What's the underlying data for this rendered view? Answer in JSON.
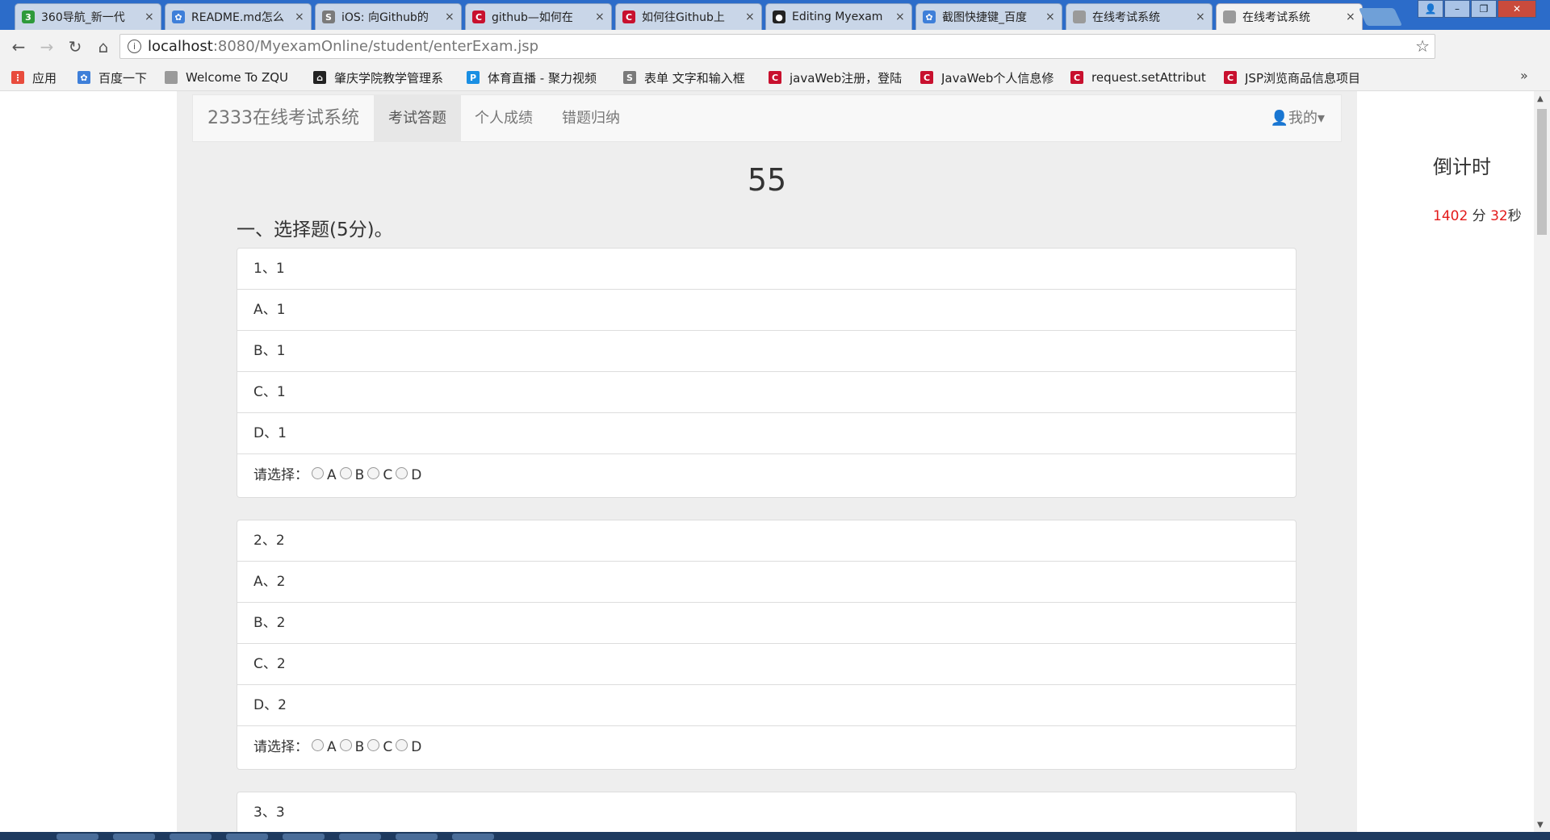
{
  "browser": {
    "tabs": [
      {
        "title": "360导航_新一代",
        "color": "#2e9a3b",
        "glyph": "3"
      },
      {
        "title": "README.md怎么",
        "color": "#3e7fd9",
        "glyph": "✿"
      },
      {
        "title": "iOS: 向Github的",
        "color": "#7a7a7a",
        "glyph": "S"
      },
      {
        "title": "github—如何在",
        "color": "#c8102e",
        "glyph": "C"
      },
      {
        "title": "如何往Github上",
        "color": "#c8102e",
        "glyph": "C"
      },
      {
        "title": "Editing Myexam",
        "color": "#222222",
        "glyph": "●"
      },
      {
        "title": "截图快捷键_百度",
        "color": "#3e7fd9",
        "glyph": "✿"
      },
      {
        "title": "在线考试系统",
        "color": "#9a9a9a",
        "glyph": ""
      },
      {
        "title": "在线考试系统",
        "color": "#9a9a9a",
        "glyph": ""
      }
    ],
    "tab_close": "×",
    "url_host": "localhost",
    "url_path": ":8080/MyexamOnline/student/enterExam.jsp",
    "bookmarks": [
      {
        "label": "应用",
        "color": "#e84c3d",
        "glyph": "⋮"
      },
      {
        "label": "百度一下",
        "color": "#3e7fd9",
        "glyph": "✿"
      },
      {
        "label": "Welcome To ZQU",
        "color": "#9a9a9a",
        "glyph": ""
      },
      {
        "label": "肇庆学院教学管理系",
        "color": "#222222",
        "glyph": "⌂"
      },
      {
        "label": "体育直播 - 聚力视频",
        "color": "#1a8fe3",
        "glyph": "P"
      },
      {
        "label": "表单 文字和输入框",
        "color": "#7a7a7a",
        "glyph": "S"
      },
      {
        "label": "javaWeb注册，登陆",
        "color": "#c8102e",
        "glyph": "C"
      },
      {
        "label": "JavaWeb个人信息修",
        "color": "#c8102e",
        "glyph": "C"
      },
      {
        "label": "request.setAttribut",
        "color": "#c8102e",
        "glyph": "C"
      },
      {
        "label": "JSP浏览商品信息项目",
        "color": "#c8102e",
        "glyph": "C"
      }
    ],
    "bookmarks_more": "»"
  },
  "navbar": {
    "brand": "2333在线考试系统",
    "links": [
      "考试答题",
      "个人成绩",
      "错题归纳"
    ],
    "active_link": "考试答题",
    "user_menu": "👤我的▾"
  },
  "exam": {
    "score": "55",
    "section_title": "一、选择题(5分)。",
    "answer_prompt": "请选择：",
    "option_letters": [
      "A",
      "B",
      "C",
      "D"
    ],
    "questions": [
      {
        "stem": "1、1",
        "options": [
          "A、1",
          "B、1",
          "C、1",
          "D、1"
        ]
      },
      {
        "stem": "2、2",
        "options": [
          "A、2",
          "B、2",
          "C、2",
          "D、2"
        ]
      },
      {
        "stem": "3、3",
        "options": []
      }
    ]
  },
  "countdown": {
    "title": "倒计时",
    "minutes": "1402",
    "minutes_unit": " 分 ",
    "seconds": "32",
    "seconds_unit": "秒"
  }
}
